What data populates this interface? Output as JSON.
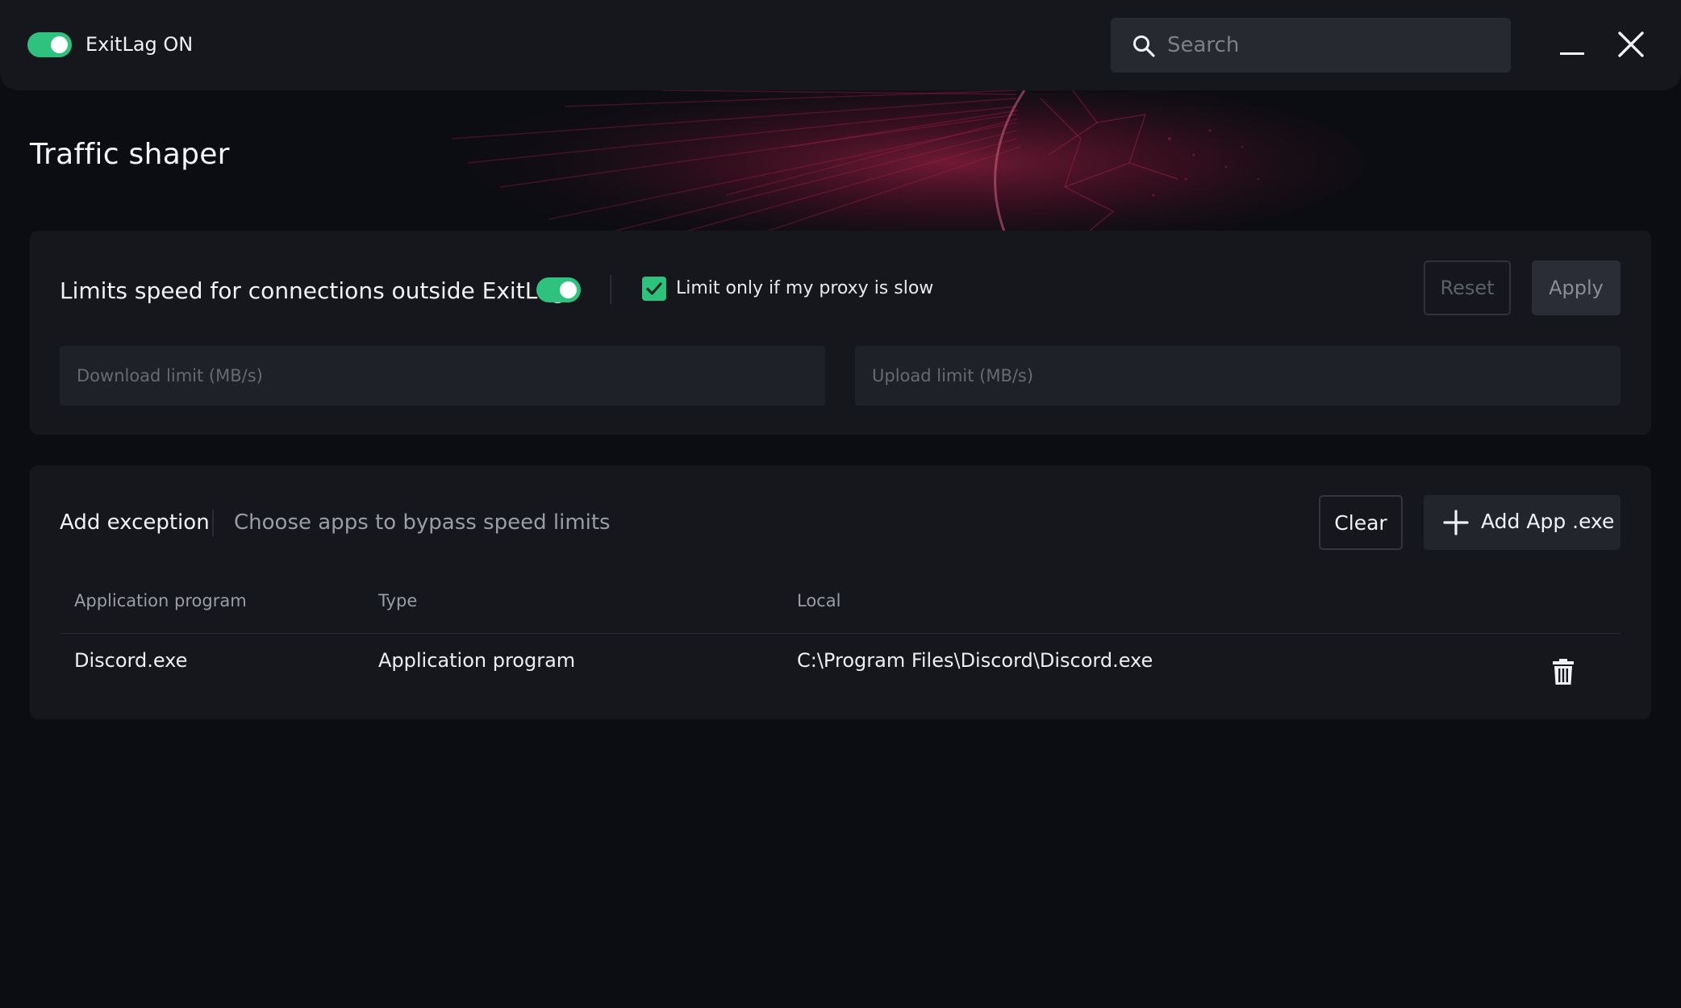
{
  "topbar": {
    "status_label": "ExitLag ON",
    "toggle_on": true,
    "search": {
      "placeholder": "Search",
      "value": ""
    }
  },
  "page": {
    "title": "Traffic shaper"
  },
  "limits": {
    "label": "Limits speed for connections outside ExitLag",
    "toggle_on": true,
    "proxy_checkbox_label": "Limit only if my proxy is slow",
    "proxy_checkbox_checked": true,
    "reset_label": "Reset",
    "apply_label": "Apply",
    "download_placeholder": "Download limit (MB/s)",
    "upload_placeholder": "Upload limit (MB/s)"
  },
  "exceptions": {
    "title": "Add exception",
    "subtitle": "Choose apps to bypass speed limits",
    "clear_label": "Clear",
    "add_label": "Add App .exe",
    "columns": [
      "Application program",
      "Type",
      "Local"
    ],
    "rows": [
      {
        "app": "Discord.exe",
        "type": "Application program",
        "local": "C:\\Program Files\\Discord\\Discord.exe"
      }
    ]
  },
  "colors": {
    "accent": "#2ec27e",
    "background": "#0c0d12",
    "card": "#15171d",
    "banner_glow": "#c0184a"
  },
  "icons": [
    "search-icon",
    "minimize-icon",
    "close-icon",
    "check-icon",
    "plus-icon",
    "trash-icon"
  ]
}
